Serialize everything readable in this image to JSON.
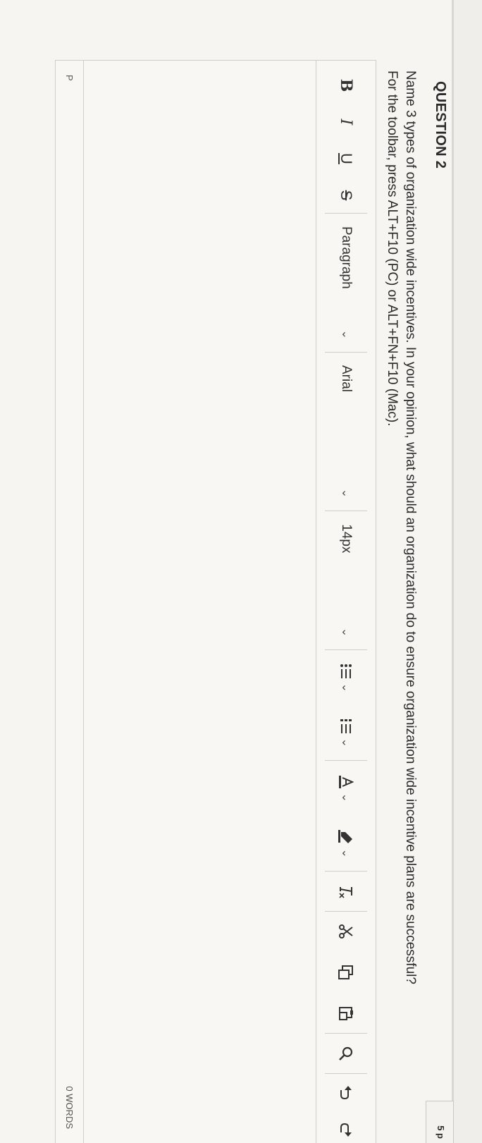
{
  "question": {
    "title": "QUESTION 2",
    "points": "5 p",
    "text": "Name 3 types of organization wide incentives. In your opinion, what should an organization do to ensure organization wide incentive plans are successful?",
    "help": "For the toolbar, press ALT+F10 (PC) or ALT+FN+F10 (Mac)."
  },
  "toolbar": {
    "bold": "B",
    "italic": "I",
    "underline": "U",
    "strikethrough": "S",
    "block_format": "Paragraph",
    "font_family": "Arial",
    "font_size": "14px",
    "chevron": "⌄",
    "icons": [
      "bullet-list-icon",
      "numbered-list-icon",
      "text-color-icon",
      "highlight-icon",
      "clear-format-icon",
      "cut-icon",
      "copy-icon",
      "paste-icon",
      "find-icon",
      "undo-icon",
      "redo-icon"
    ]
  },
  "editor": {
    "status_path": "P",
    "word_count": "0 WORDS"
  }
}
